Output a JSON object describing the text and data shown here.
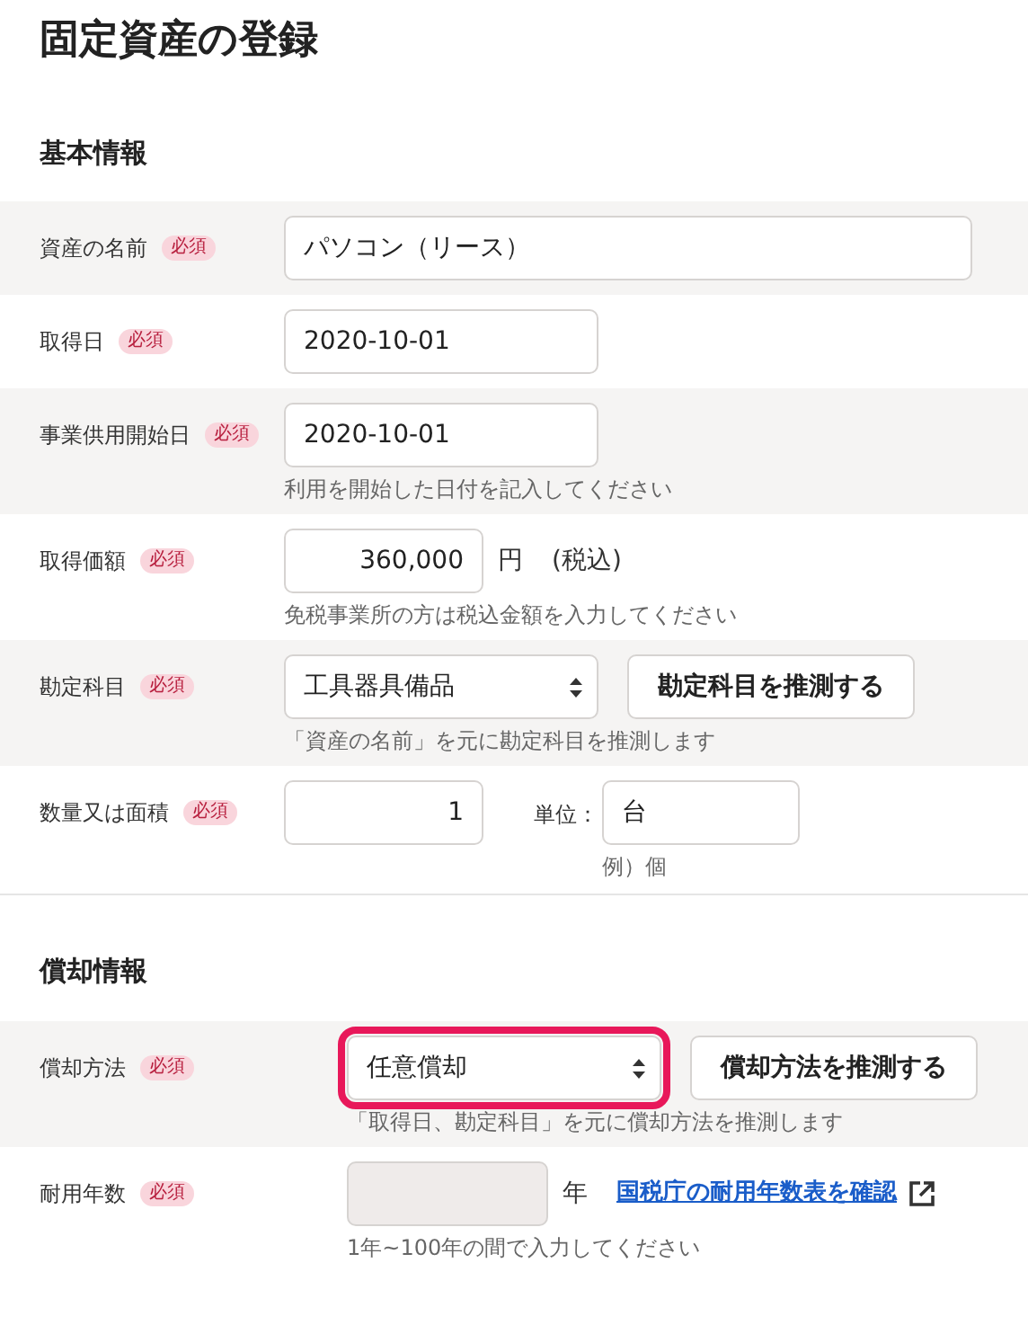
{
  "title": "固定資産の登録",
  "sections": [
    {
      "title": "基本情報",
      "rows": [
        {
          "label": "資産の名前",
          "badge": "必須",
          "controls": [
            {
              "kind": "wide_input",
              "value": "パソコン（リース）"
            }
          ]
        },
        {
          "label": "取得日",
          "badge": "必須",
          "controls": [
            {
              "kind": "date_input",
              "value": "2020-10-01"
            }
          ]
        },
        {
          "label": "事業供用開始日",
          "badge": "必須",
          "controls": [
            {
              "kind": "date_input",
              "value": "2020-10-01"
            }
          ],
          "hint": "利用を開始した日付を記入してください"
        },
        {
          "label": "取得価額",
          "badge": "必須",
          "controls": [
            {
              "kind": "number_input",
              "value": "360,000"
            },
            {
              "kind": "suffix",
              "text": "円"
            },
            {
              "kind": "suffix",
              "text": "(税込)"
            }
          ],
          "hint": "免税事業所の方は税込金額を入力してください"
        },
        {
          "label": "勘定科目",
          "badge": "必須",
          "controls": [
            {
              "kind": "select",
              "value": "工具器具備品",
              "highlighted": false
            },
            {
              "kind": "button",
              "label": "勘定科目を推測する"
            }
          ],
          "hint": "「資産の名前」を元に勘定科目を推測します"
        },
        {
          "label": "数量又は面積",
          "badge": "必須",
          "controls": [
            {
              "kind": "number_input",
              "value": "1"
            },
            {
              "kind": "unit_field",
              "label": "単位：",
              "value": "台",
              "hint": "例）個"
            }
          ]
        }
      ]
    },
    {
      "title": "償却情報",
      "rows": [
        {
          "label": "償却方法",
          "badge": "必須",
          "controls": [
            {
              "kind": "select",
              "value": "任意償却",
              "highlighted": true
            },
            {
              "kind": "button",
              "label": "償却方法を推測する"
            }
          ],
          "hint": "「取得日、勘定科目」を元に償却方法を推測します"
        },
        {
          "label": "耐用年数",
          "badge": "必須",
          "controls": [
            {
              "kind": "years_input",
              "disabled": true
            },
            {
              "kind": "suffix",
              "text": "年"
            },
            {
              "kind": "link",
              "text": "国税庁の耐用年数表を確認"
            }
          ],
          "hint": "1年~100年の間で入力してください"
        }
      ]
    }
  ]
}
